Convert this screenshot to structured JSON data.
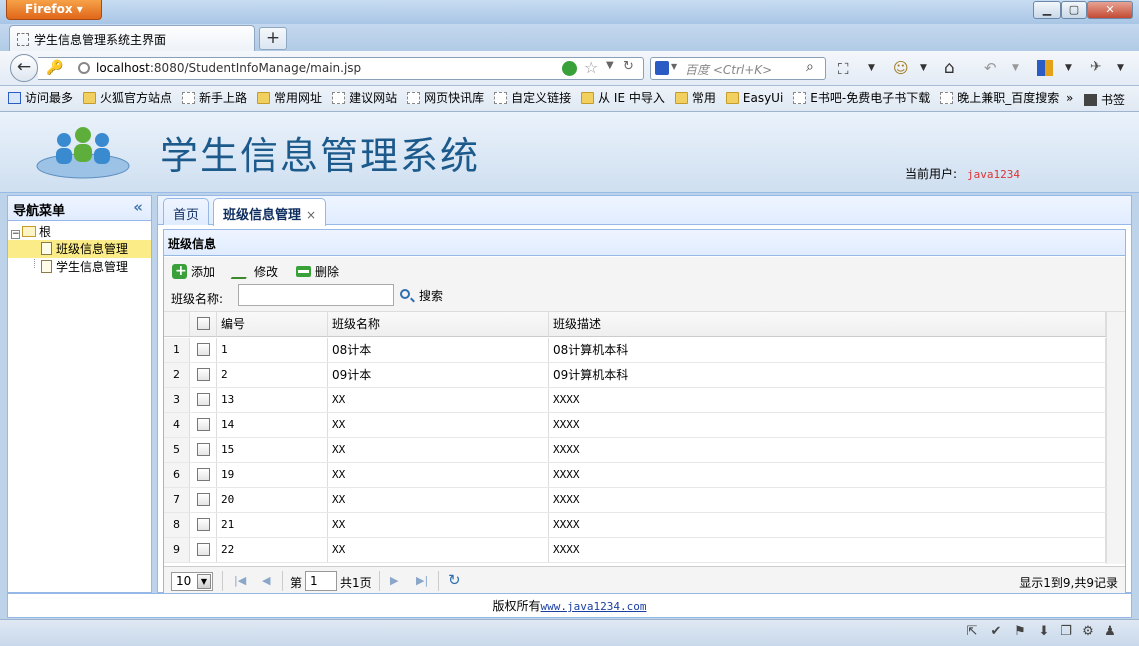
{
  "browser": {
    "menu_label": "Firefox",
    "tab_title": "学生信息管理系统主界面",
    "new_tab": "+",
    "url_host": "localhost",
    "url_rest": ":8080/StudentInfoManage/main.jsp",
    "search_placeholder": "百度 <Ctrl+K>",
    "bookmarks": [
      "访问最多",
      "火狐官方站点",
      "新手上路",
      "常用网址",
      "建议网站",
      "网页快讯库",
      "自定义链接",
      "从 IE 中导入",
      "常用",
      "EasyUi",
      "E书吧-免费电子书下载",
      "晚上兼职_百度搜索"
    ],
    "bookmarks_more": "»",
    "bookmarks_label": "书签"
  },
  "app": {
    "title": "学生信息管理系统",
    "current_user_label": "当前用户:",
    "current_user": "java1234"
  },
  "nav": {
    "title": "导航菜单",
    "collapse": "«",
    "root": "根",
    "items": [
      "班级信息管理",
      "学生信息管理"
    ]
  },
  "tabs": {
    "home": "首页",
    "active": "班级信息管理",
    "close": "×"
  },
  "grid": {
    "title": "班级信息",
    "toolbar": {
      "add": "添加",
      "edit": "修改",
      "delete": "删除"
    },
    "search": {
      "label": "班级名称:",
      "value": "",
      "button": "搜索"
    },
    "columns": [
      "编号",
      "班级名称",
      "班级描述"
    ],
    "rows": [
      {
        "n": "1",
        "id": "1",
        "name": "08计本",
        "desc": "08计算机本科"
      },
      {
        "n": "2",
        "id": "2",
        "name": "09计本",
        "desc": "09计算机本科"
      },
      {
        "n": "3",
        "id": "13",
        "name": "XX",
        "desc": "XXXX"
      },
      {
        "n": "4",
        "id": "14",
        "name": "XX",
        "desc": "XXXX"
      },
      {
        "n": "5",
        "id": "15",
        "name": "XX",
        "desc": "XXXX"
      },
      {
        "n": "6",
        "id": "19",
        "name": "XX",
        "desc": "XXXX"
      },
      {
        "n": "7",
        "id": "20",
        "name": "XX",
        "desc": "XXXX"
      },
      {
        "n": "8",
        "id": "21",
        "name": "XX",
        "desc": "XXXX"
      },
      {
        "n": "9",
        "id": "22",
        "name": "XX",
        "desc": "XXXX"
      }
    ],
    "pager": {
      "page_size": "10",
      "page_label_pre": "第",
      "page_value": "1",
      "page_label_post": "共1页",
      "info": "显示1到9,共9记录"
    }
  },
  "footer": {
    "text": "版权所有",
    "link": "www.java1234.com"
  }
}
